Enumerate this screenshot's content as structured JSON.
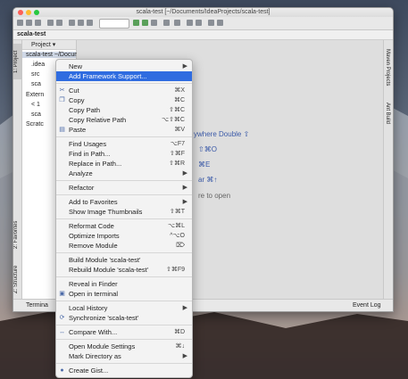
{
  "window": {
    "title": "scala-test [~/Documents/IdeaProjects/scala-test]",
    "breadcrumb": "scala-test",
    "traffic_colors": [
      "#fc5f57",
      "#fdbc2e",
      "#28c840"
    ]
  },
  "project_panel": {
    "view_label": "Project ▾",
    "tree": [
      {
        "label": "scala-test ~/Documents/IdeaP",
        "selected": true
      },
      {
        "label": ".idea",
        "selected": false
      },
      {
        "label": "src",
        "selected": false
      },
      {
        "label": "sca",
        "selected": false
      },
      {
        "label": "Extern",
        "selected": false
      },
      {
        "label": "< 1",
        "selected": false
      },
      {
        "label": "sca",
        "selected": false
      },
      {
        "label": "Scratc",
        "selected": false
      }
    ]
  },
  "left_tool_tabs": {
    "project": "1: Project",
    "favorites": "2: Favorites",
    "structure": "Z: Structure"
  },
  "right_tool_tabs": {
    "maven": "Maven Projects",
    "ant": "Ant Build"
  },
  "editor_hints": {
    "search": "ywhere Double ⇧",
    "goto_file": "⇧⌘O",
    "recent": "⌘E",
    "nav_bar": "ar ⌘↑",
    "drop": "re to open"
  },
  "bottom_bar": {
    "terminal": "Termina",
    "event_log": "Event Log"
  },
  "context_menu": {
    "items": [
      {
        "type": "item",
        "label": "New",
        "submenu": true,
        "shortcut": ""
      },
      {
        "type": "item",
        "label": "Add Framework Support...",
        "highlighted": true,
        "shortcut": ""
      },
      {
        "type": "sep"
      },
      {
        "type": "item",
        "label": "Cut",
        "shortcut": "⌘X",
        "icon": "✂"
      },
      {
        "type": "item",
        "label": "Copy",
        "shortcut": "⌘C",
        "icon": "❐"
      },
      {
        "type": "item",
        "label": "Copy Path",
        "shortcut": "⇧⌘C"
      },
      {
        "type": "item",
        "label": "Copy Relative Path",
        "shortcut": "⌥⇧⌘C"
      },
      {
        "type": "item",
        "label": "Paste",
        "shortcut": "⌘V",
        "icon": "▤"
      },
      {
        "type": "sep"
      },
      {
        "type": "item",
        "label": "Find Usages",
        "shortcut": "⌥F7"
      },
      {
        "type": "item",
        "label": "Find in Path...",
        "shortcut": "⇧⌘F"
      },
      {
        "type": "item",
        "label": "Replace in Path...",
        "shortcut": "⇧⌘R"
      },
      {
        "type": "item",
        "label": "Analyze",
        "submenu": true,
        "shortcut": ""
      },
      {
        "type": "sep"
      },
      {
        "type": "item",
        "label": "Refactor",
        "submenu": true,
        "shortcut": ""
      },
      {
        "type": "sep"
      },
      {
        "type": "item",
        "label": "Add to Favorites",
        "submenu": true,
        "shortcut": ""
      },
      {
        "type": "item",
        "label": "Show Image Thumbnails",
        "shortcut": "⇧⌘T"
      },
      {
        "type": "sep"
      },
      {
        "type": "item",
        "label": "Reformat Code",
        "shortcut": "⌥⌘L"
      },
      {
        "type": "item",
        "label": "Optimize Imports",
        "shortcut": "^⌥O"
      },
      {
        "type": "item",
        "label": "Remove Module",
        "shortcut": "⌦"
      },
      {
        "type": "sep"
      },
      {
        "type": "item",
        "label": "Build Module 'scala-test'",
        "shortcut": ""
      },
      {
        "type": "item",
        "label": "Rebuild Module 'scala-test'",
        "shortcut": "⇧⌘F9"
      },
      {
        "type": "sep"
      },
      {
        "type": "item",
        "label": "Reveal in Finder",
        "shortcut": ""
      },
      {
        "type": "item",
        "label": "Open in terminal",
        "shortcut": "",
        "icon": "▣"
      },
      {
        "type": "sep"
      },
      {
        "type": "item",
        "label": "Local History",
        "submenu": true,
        "shortcut": ""
      },
      {
        "type": "item",
        "label": "Synchronize 'scala-test'",
        "shortcut": "",
        "icon": "⟳"
      },
      {
        "type": "sep"
      },
      {
        "type": "item",
        "label": "Compare With...",
        "shortcut": "⌘D",
        "icon": "↔"
      },
      {
        "type": "sep"
      },
      {
        "type": "item",
        "label": "Open Module Settings",
        "shortcut": "⌘↓"
      },
      {
        "type": "item",
        "label": "Mark Directory as",
        "submenu": true,
        "shortcut": ""
      },
      {
        "type": "sep"
      },
      {
        "type": "item",
        "label": "Create Gist...",
        "shortcut": "",
        "icon": "●"
      }
    ]
  }
}
